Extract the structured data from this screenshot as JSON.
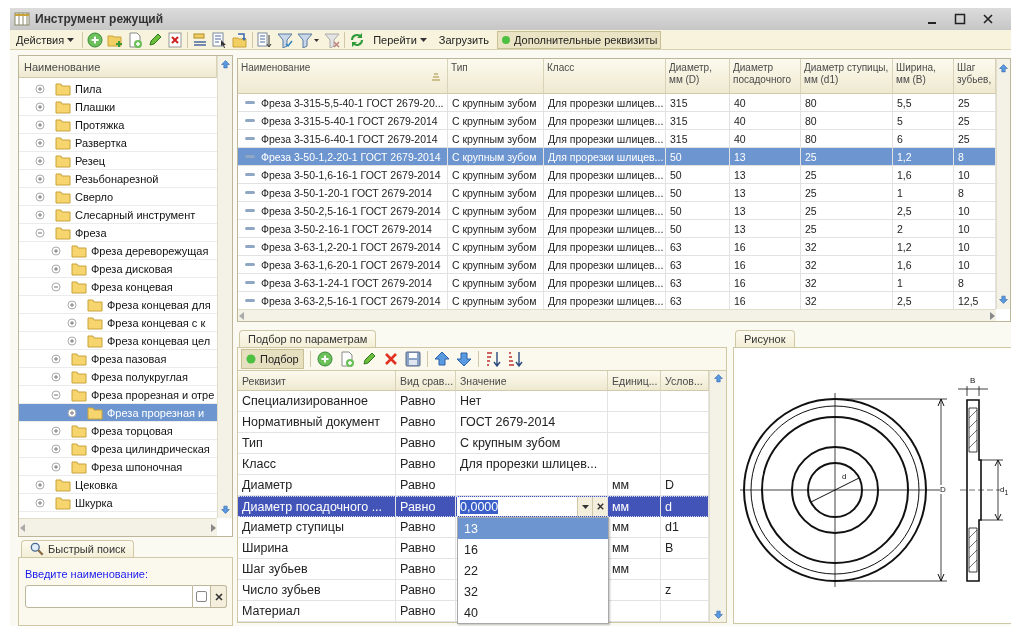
{
  "window": {
    "title": "Инструмент режущий"
  },
  "toolbar": {
    "actions_menu": "Действия",
    "goto_menu": "Перейти",
    "load_button": "Загрузить",
    "extra_attributes": {
      "label": "Дополнительные реквизиты",
      "on": true
    }
  },
  "tree": {
    "column": "Наименование",
    "items": [
      {
        "label": "Пила",
        "expanded": false,
        "selected": false
      },
      {
        "label": "Плашки",
        "expanded": false,
        "selected": false
      },
      {
        "label": "Протяжка",
        "expanded": false,
        "selected": false
      },
      {
        "label": "Развертка",
        "expanded": false,
        "selected": false
      },
      {
        "label": "Резец",
        "expanded": false,
        "selected": false
      },
      {
        "label": "Резьбонарезной",
        "expanded": false,
        "selected": false
      },
      {
        "label": "Сверло",
        "expanded": false,
        "selected": false
      },
      {
        "label": "Слесарный инструмент",
        "expanded": false,
        "selected": false
      },
      {
        "label": "Фреза",
        "expanded": true,
        "selected": false,
        "children": [
          {
            "label": "Фреза дереворежущая",
            "expanded": false,
            "selected": false
          },
          {
            "label": "Фреза дисковая",
            "expanded": false,
            "selected": false
          },
          {
            "label": "Фреза концевая",
            "expanded": true,
            "selected": false,
            "children": [
              {
                "label": "Фреза концевая для",
                "expanded": false,
                "selected": false
              },
              {
                "label": "Фреза концевая с к",
                "expanded": false,
                "selected": false
              },
              {
                "label": "Фреза концевая цел",
                "expanded": false,
                "selected": false
              }
            ]
          },
          {
            "label": "Фреза пазовая",
            "expanded": false,
            "selected": false
          },
          {
            "label": "Фреза полукруглая",
            "expanded": false,
            "selected": false
          },
          {
            "label": "Фреза прорезная и отре",
            "expanded": true,
            "selected": false,
            "children": [
              {
                "label": "Фреза прорезная и",
                "expanded": false,
                "selected": true
              }
            ]
          },
          {
            "label": "Фреза торцовая",
            "expanded": false,
            "selected": false
          },
          {
            "label": "Фреза цилиндрическая",
            "expanded": false,
            "selected": false
          },
          {
            "label": "Фреза шпоночная",
            "expanded": false,
            "selected": false
          }
        ]
      },
      {
        "label": "Цековка",
        "expanded": false,
        "selected": false
      },
      {
        "label": "Шкурка",
        "expanded": false,
        "selected": false
      }
    ]
  },
  "quick_search": {
    "tab": "Быстрый поиск",
    "label": "Введите наименование:",
    "checked": false
  },
  "table": {
    "columns": [
      {
        "label": "Наименование",
        "sorted": true
      },
      {
        "label": "Тип",
        "sorted": false
      },
      {
        "label": "Класс",
        "sorted": false
      },
      {
        "label": "Диаметр, мм (D)",
        "sorted": false
      },
      {
        "label": "Диаметр посадочного",
        "sorted": false
      },
      {
        "label": "Диаметр ступицы, мм (d1)",
        "sorted": false
      },
      {
        "label": "Ширина, мм (B)",
        "sorted": false
      },
      {
        "label": "Шаг зубьев,",
        "sorted": false
      }
    ],
    "rows": [
      {
        "selected": false,
        "cells": [
          "Фреза 3-315-5,5-40-1 ГОСТ 2679-20...",
          "С крупным зубом",
          "Для прорезки шлицев...",
          "315",
          "40",
          "80",
          "5,5",
          "25"
        ]
      },
      {
        "selected": false,
        "cells": [
          "Фреза 3-315-5-40-1 ГОСТ 2679-2014",
          "С крупным зубом",
          "Для прорезки шлицев...",
          "315",
          "40",
          "80",
          "5",
          "25"
        ]
      },
      {
        "selected": false,
        "cells": [
          "Фреза 3-315-6-40-1 ГОСТ 2679-2014",
          "С крупным зубом",
          "Для прорезки шлицев...",
          "315",
          "40",
          "80",
          "6",
          "25"
        ]
      },
      {
        "selected": true,
        "cells": [
          "Фреза 3-50-1,2-20-1 ГОСТ 2679-2014",
          "С крупным зубом",
          "Для прорезки шлицев...",
          "50",
          "13",
          "25",
          "1,2",
          "8"
        ]
      },
      {
        "selected": false,
        "cells": [
          "Фреза 3-50-1,6-16-1 ГОСТ 2679-2014",
          "С крупным зубом",
          "Для прорезки шлицев...",
          "50",
          "13",
          "25",
          "1,6",
          "10"
        ]
      },
      {
        "selected": false,
        "cells": [
          "Фреза 3-50-1-20-1 ГОСТ 2679-2014",
          "С крупным зубом",
          "Для прорезки шлицев...",
          "50",
          "13",
          "25",
          "1",
          "8"
        ]
      },
      {
        "selected": false,
        "cells": [
          "Фреза 3-50-2,5-16-1 ГОСТ 2679-2014",
          "С крупным зубом",
          "Для прорезки шлицев...",
          "50",
          "13",
          "25",
          "2,5",
          "10"
        ]
      },
      {
        "selected": false,
        "cells": [
          "Фреза 3-50-2-16-1 ГОСТ 2679-2014",
          "С крупным зубом",
          "Для прорезки шлицев...",
          "50",
          "13",
          "25",
          "2",
          "10"
        ]
      },
      {
        "selected": false,
        "cells": [
          "Фреза 3-63-1,2-20-1 ГОСТ 2679-2014",
          "С крупным зубом",
          "Для прорезки шлицев...",
          "63",
          "16",
          "32",
          "1,2",
          "10"
        ]
      },
      {
        "selected": false,
        "cells": [
          "Фреза 3-63-1,6-20-1 ГОСТ 2679-2014",
          "С крупным зубом",
          "Для прорезки шлицев...",
          "63",
          "16",
          "32",
          "1,6",
          "10"
        ]
      },
      {
        "selected": false,
        "cells": [
          "Фреза 3-63-1-24-1 ГОСТ 2679-2014",
          "С крупным зубом",
          "Для прорезки шлицев...",
          "63",
          "16",
          "32",
          "1",
          "8"
        ]
      },
      {
        "selected": false,
        "cells": [
          "Фреза 3-63-2,5-16-1 ГОСТ 2679-2014",
          "С крупным зубом",
          "Для прорезки шлицев...",
          "63",
          "16",
          "32",
          "2,5",
          "12,5"
        ]
      }
    ]
  },
  "params": {
    "tab": "Подбор по параметрам",
    "pick_button": {
      "label": "Подбор",
      "on": true
    },
    "columns": [
      "Реквизит",
      "Вид срав...",
      "Значение",
      "Единиц...",
      "Услов..."
    ],
    "rows": [
      {
        "selected": false,
        "attribute": "Специализированное",
        "comparison": "Равно",
        "value": "Нет"
      },
      {
        "selected": false,
        "attribute": "Нормативный документ",
        "comparison": "Равно",
        "value": "ГОСТ 2679-2014"
      },
      {
        "selected": false,
        "attribute": "Тип",
        "comparison": "Равно",
        "value": "С крупным зубом"
      },
      {
        "selected": false,
        "attribute": "Класс",
        "comparison": "Равно",
        "value": "Для прорезки шлицев..."
      },
      {
        "selected": false,
        "attribute": "Диаметр",
        "comparison": "Равно",
        "unit": "мм",
        "condition": "D"
      },
      {
        "selected": true,
        "attribute": "Диаметр посадочного ...",
        "comparison": "Равно",
        "value": "0,0000",
        "editing": true,
        "unit": "мм",
        "condition": "d"
      },
      {
        "selected": false,
        "attribute": "Диаметр ступицы",
        "comparison": "Равно",
        "unit": "мм",
        "condition": "d1"
      },
      {
        "selected": false,
        "attribute": "Ширина",
        "comparison": "Равно",
        "unit": "мм",
        "condition": "B"
      },
      {
        "selected": false,
        "attribute": "Шаг зубьев",
        "comparison": "Равно",
        "unit": "мм"
      },
      {
        "selected": false,
        "attribute": "Число зубьев",
        "comparison": "Равно",
        "condition": "z"
      },
      {
        "selected": false,
        "attribute": "Материал",
        "comparison": "Равно"
      }
    ],
    "dropdown": [
      {
        "label": "13",
        "selected": true
      },
      {
        "label": "16",
        "selected": false
      },
      {
        "label": "22",
        "selected": false
      },
      {
        "label": "32",
        "selected": false
      },
      {
        "label": "40",
        "selected": false
      }
    ]
  },
  "picture_panel": {
    "tab": "Рисунок",
    "dimension_labels": [
      "d",
      "D",
      "B",
      "d$_{1}$"
    ]
  }
}
